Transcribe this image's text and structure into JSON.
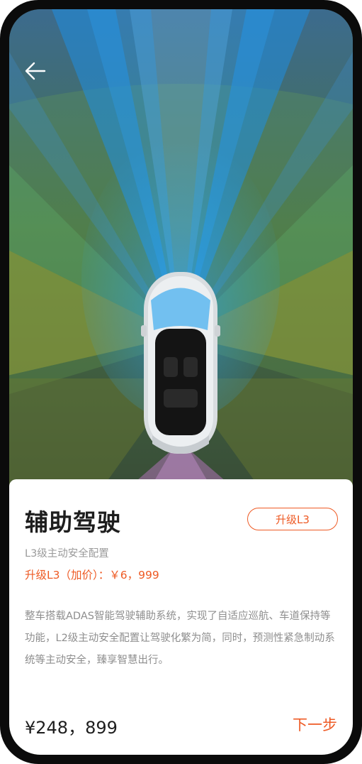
{
  "nav": {
    "back_icon": "arrow-left-icon"
  },
  "feature": {
    "title": "辅助驾驶",
    "subtitle": "L3级主动安全配置",
    "upgrade_label": "升级L3",
    "upgrade_price": "升级L3（加价）：￥6，999",
    "description": "整车搭载ADAS智能驾驶辅助系统，实现了自适应巡航、车道保持等功能，L2级主动安全配置让驾驶化繁为简，同时，预测性紧急制动系统等主动安全，臻享智慧出行。"
  },
  "footer": {
    "total_price": "¥248，899",
    "next_label": "下一步"
  },
  "colors": {
    "accent": "#ee5a24",
    "sensor_blue": "#1f8ee0",
    "sensor_green": "#7fbf5a",
    "sensor_olive": "#9a9a2a"
  }
}
